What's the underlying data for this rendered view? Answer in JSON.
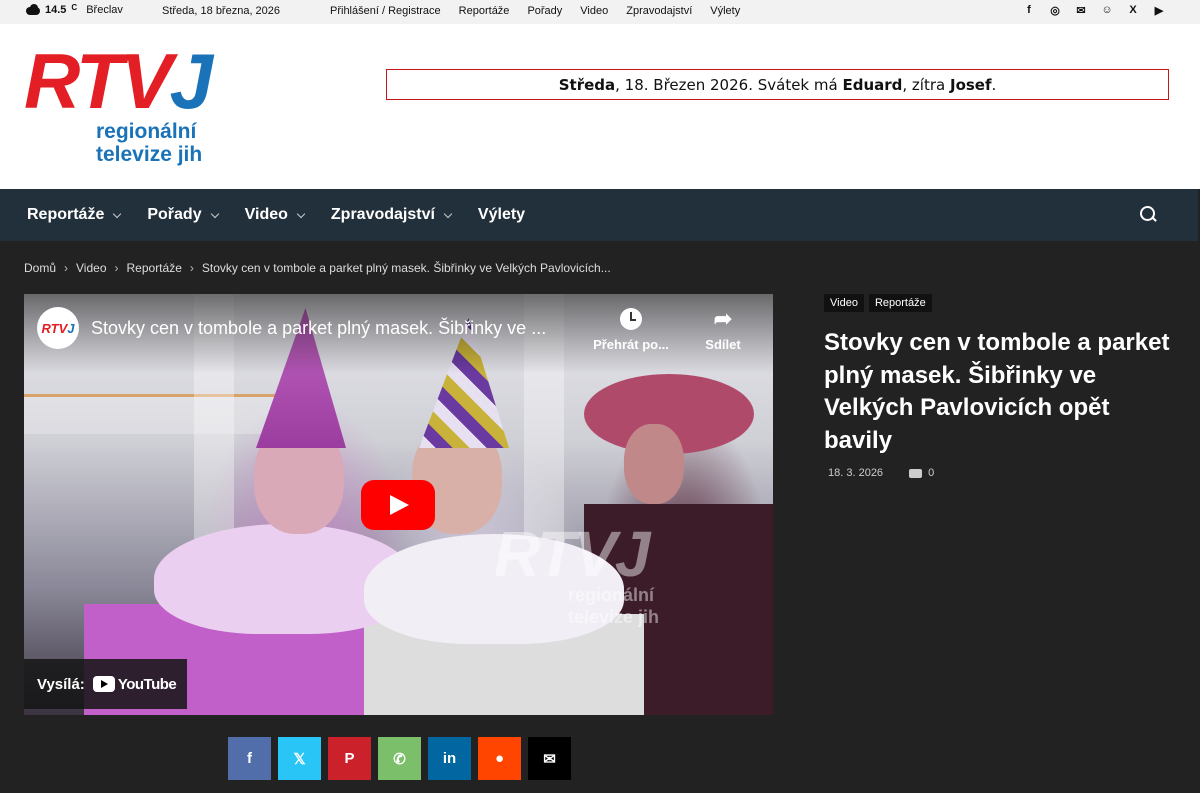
{
  "topbar": {
    "temperature": "14.5",
    "unit": "C",
    "city": "Břeclav",
    "date": "Středa, 18 března, 2026",
    "links": [
      "Přihlášení / Registrace",
      "Reportáže",
      "Pořady",
      "Video",
      "Zpravodajství",
      "Výlety"
    ],
    "social_icons": [
      "facebook-icon",
      "instagram-icon",
      "mail-icon",
      "reddit-icon",
      "x-icon",
      "youtube-icon"
    ]
  },
  "header": {
    "logo_text": "RTVJ",
    "logo_sub1": "regionální",
    "logo_sub2": "televize jih",
    "nameday": {
      "day": "Středa",
      "date": ", 18. Březen 2026. Svátek má ",
      "name_today": "Eduard",
      "tomorrow_label": ", zítra ",
      "name_tomorrow": "Josef",
      "end": "."
    }
  },
  "nav": {
    "items": [
      {
        "label": "Reportáže",
        "dropdown": true
      },
      {
        "label": "Pořady",
        "dropdown": true
      },
      {
        "label": "Video",
        "dropdown": true
      },
      {
        "label": "Zpravodajství",
        "dropdown": true
      },
      {
        "label": "Výlety",
        "dropdown": false
      }
    ]
  },
  "breadcrumb": [
    "Domů",
    "Video",
    "Reportáže",
    "Stovky cen v tombole a parket plný masek. Šibřinky ve Velkých Pavlovicích..."
  ],
  "video": {
    "channel": "RTVJ",
    "title": "Stovky cen v tombole a parket plný masek. Šibřinky ve ...",
    "watch_later": "Přehrát po...",
    "share": "Sdílet",
    "watermark1": "RTVJ",
    "watermark2": "regionální\ntelevize jih",
    "youtube_label": "Vysílá:",
    "youtube_brand": "YouTube"
  },
  "article": {
    "tags": [
      "Video",
      "Reportáže"
    ],
    "title": "Stovky cen v tombole a parket plný masek. Šibřinky ve Velkých Pavlovicích opět bavily",
    "date": "18. 3. 2026",
    "comments": "0"
  },
  "share_buttons": [
    {
      "name": "facebook",
      "glyph": "f",
      "color": "#516eab"
    },
    {
      "name": "x",
      "glyph": "𝕏",
      "color": "#29c5f6"
    },
    {
      "name": "pinterest",
      "glyph": "P",
      "color": "#ca212a"
    },
    {
      "name": "whatsapp",
      "glyph": "✆",
      "color": "#7bbf6a"
    },
    {
      "name": "linkedin",
      "glyph": "in",
      "color": "#0266a0"
    },
    {
      "name": "reddit",
      "glyph": "●",
      "color": "#ff4500"
    },
    {
      "name": "email",
      "glyph": "✉",
      "color": "#000000"
    }
  ]
}
